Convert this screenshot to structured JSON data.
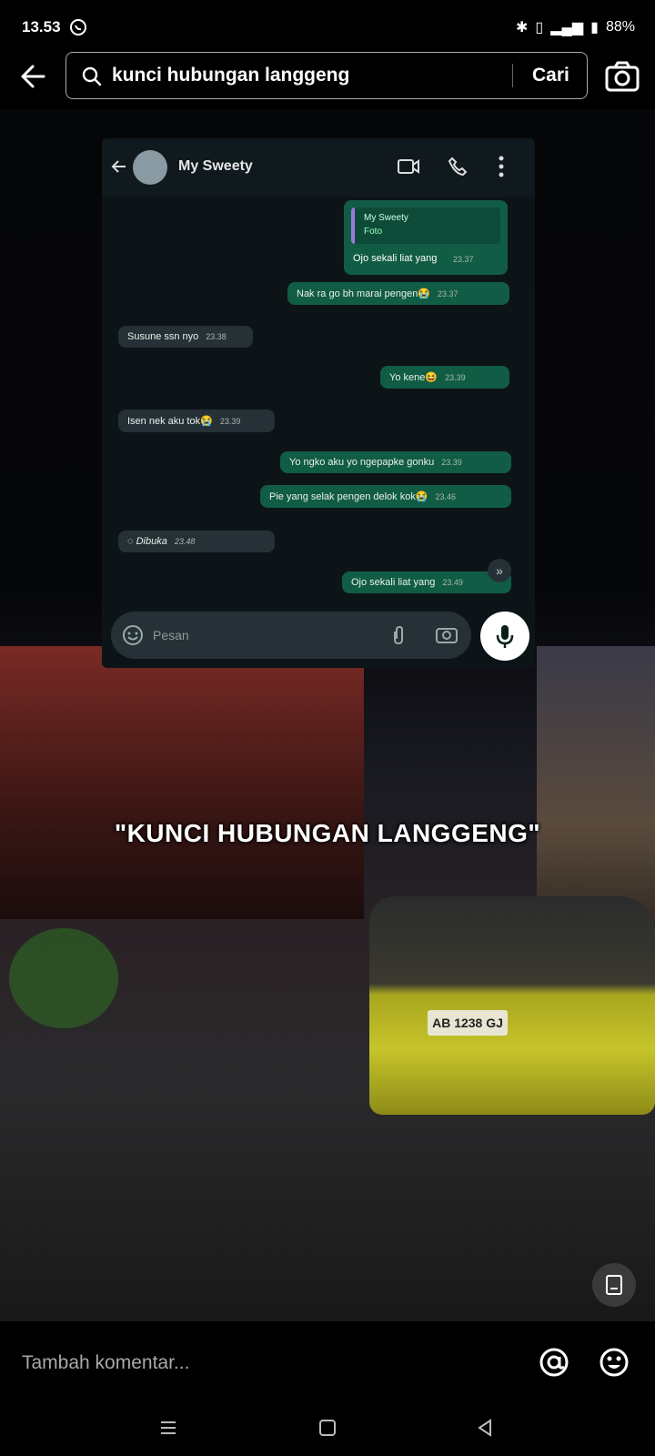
{
  "status_bar": {
    "time": "13.53",
    "battery": "88%"
  },
  "search": {
    "query": "kunci hubungan langgeng",
    "submit_label": "Cari"
  },
  "chat": {
    "contact_name": "My Sweety",
    "reply_quote": {
      "name": "My Sweety",
      "type": "Foto",
      "text": "Ojo sekali liat yang",
      "time": "23.37"
    },
    "messages": [
      {
        "text": "Nak ra go bh marai pengen😭",
        "time": "23.37"
      },
      {
        "text": "Susune ssn nyo",
        "time": "23.38"
      },
      {
        "text": "Yo kene😆",
        "time": "23.39"
      },
      {
        "text": "Isen nek aku tok😭",
        "time": "23.39"
      },
      {
        "text": "Yo ngko aku yo ngepapke gonku",
        "time": "23.39"
      },
      {
        "text": "Pie yang selak pengen delok kok😭",
        "time": "23.46"
      },
      {
        "text": "Dibuka",
        "time": "23.48"
      },
      {
        "text": "Ojo sekali liat yang",
        "time": "23.49"
      }
    ],
    "input_placeholder": "Pesan"
  },
  "video": {
    "caption": "\"KUNCI HUBUNGAN LANGGENG\"",
    "plate": "AB 1238 GJ"
  },
  "comment": {
    "placeholder": "Tambah komentar..."
  },
  "icons": [
    "back-arrow-icon",
    "search-icon",
    "camera-icon",
    "video-call-icon",
    "phone-icon",
    "more-icon",
    "emoji-icon",
    "attach-icon",
    "camera-small-icon",
    "mic-icon",
    "scroll-down-icon",
    "info-icon",
    "mention-icon",
    "emoji-react-icon",
    "menu-icon",
    "home-icon",
    "back-nav-icon"
  ],
  "colors": {
    "accent": "#115c44",
    "background": "#000000"
  }
}
